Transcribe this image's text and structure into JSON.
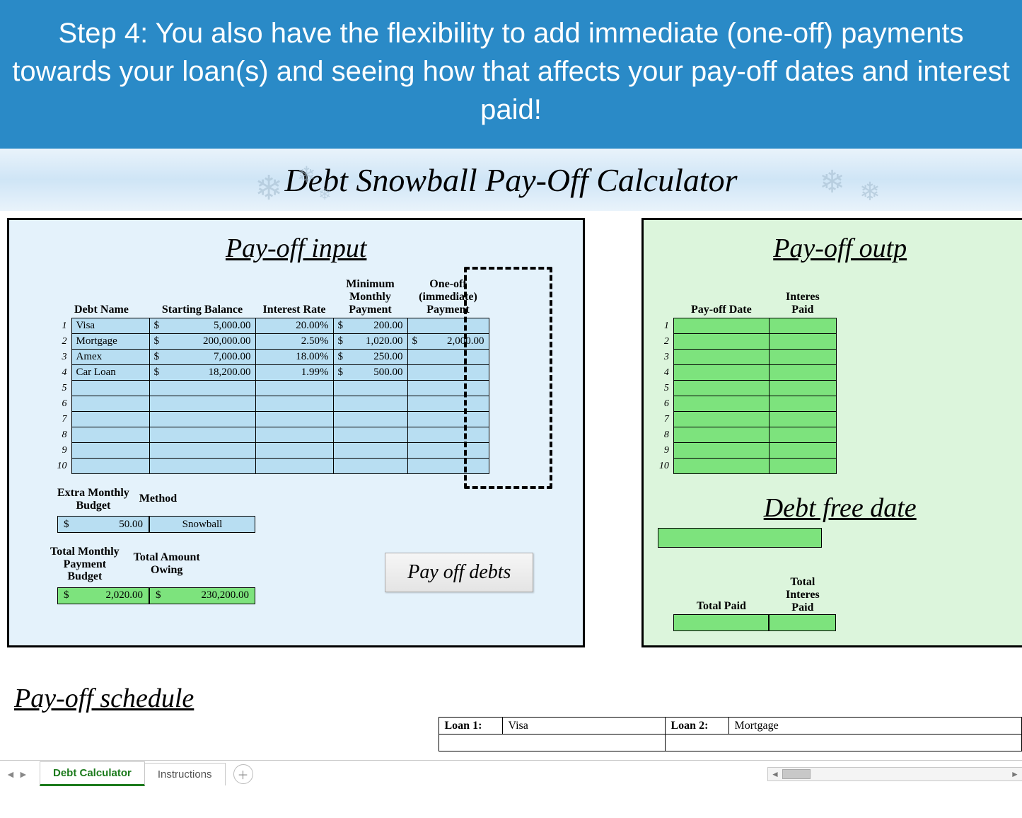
{
  "banner_text": "Step 4: You also have the flexibility to add immediate (one-off) payments towards your loan(s) and seeing how that affects your pay-off dates and interest paid!",
  "title": "Debt Snowball Pay-Off Calculator",
  "input_panel": {
    "heading": "Pay-off input",
    "columns": {
      "name": "Debt Name",
      "balance": "Starting Balance",
      "rate": "Interest Rate",
      "min": "Minimum Monthly Payment",
      "oneoff": "One-off (immediate) Payment"
    },
    "rows": [
      {
        "n": "1",
        "name": "Visa",
        "balance": "5,000.00",
        "rate": "20.00%",
        "min": "200.00",
        "one": ""
      },
      {
        "n": "2",
        "name": "Mortgage",
        "balance": "200,000.00",
        "rate": "2.50%",
        "min": "1,020.00",
        "one": "2,000.00"
      },
      {
        "n": "3",
        "name": "Amex",
        "balance": "7,000.00",
        "rate": "18.00%",
        "min": "250.00",
        "one": ""
      },
      {
        "n": "4",
        "name": "Car Loan",
        "balance": "18,200.00",
        "rate": "1.99%",
        "min": "500.00",
        "one": ""
      },
      {
        "n": "5",
        "name": "",
        "balance": "",
        "rate": "",
        "min": "",
        "one": ""
      },
      {
        "n": "6",
        "name": "",
        "balance": "",
        "rate": "",
        "min": "",
        "one": ""
      },
      {
        "n": "7",
        "name": "",
        "balance": "",
        "rate": "",
        "min": "",
        "one": ""
      },
      {
        "n": "8",
        "name": "",
        "balance": "",
        "rate": "",
        "min": "",
        "one": ""
      },
      {
        "n": "9",
        "name": "",
        "balance": "",
        "rate": "",
        "min": "",
        "one": ""
      },
      {
        "n": "10",
        "name": "",
        "balance": "",
        "rate": "",
        "min": "",
        "one": ""
      }
    ],
    "extra_budget": {
      "label": "Extra Monthly Budget",
      "value": "50.00"
    },
    "method": {
      "label": "Method",
      "value": "Snowball"
    },
    "total_monthly": {
      "label": "Total Monthly Payment Budget",
      "value": "2,020.00"
    },
    "total_owing": {
      "label": "Total Amount Owing",
      "value": "230,200.00"
    },
    "button": "Pay off debts"
  },
  "output_panel": {
    "heading": "Pay-off outp",
    "columns": {
      "date": "Pay-off Date",
      "interest": "Interes Paid"
    },
    "row_numbers": [
      "1",
      "2",
      "3",
      "4",
      "5",
      "6",
      "7",
      "8",
      "9",
      "10"
    ],
    "debt_free": {
      "label": "Debt free date"
    },
    "totals": {
      "total_paid": "Total Paid",
      "total_interest": "Total Interes Paid"
    }
  },
  "schedule": {
    "heading": "Pay-off schedule",
    "loan1_label": "Loan 1:",
    "loan1_name": "Visa",
    "loan2_label": "Loan 2:",
    "loan2_name": "Mortgage"
  },
  "tabs": {
    "active": "Debt Calculator",
    "other": "Instructions"
  }
}
